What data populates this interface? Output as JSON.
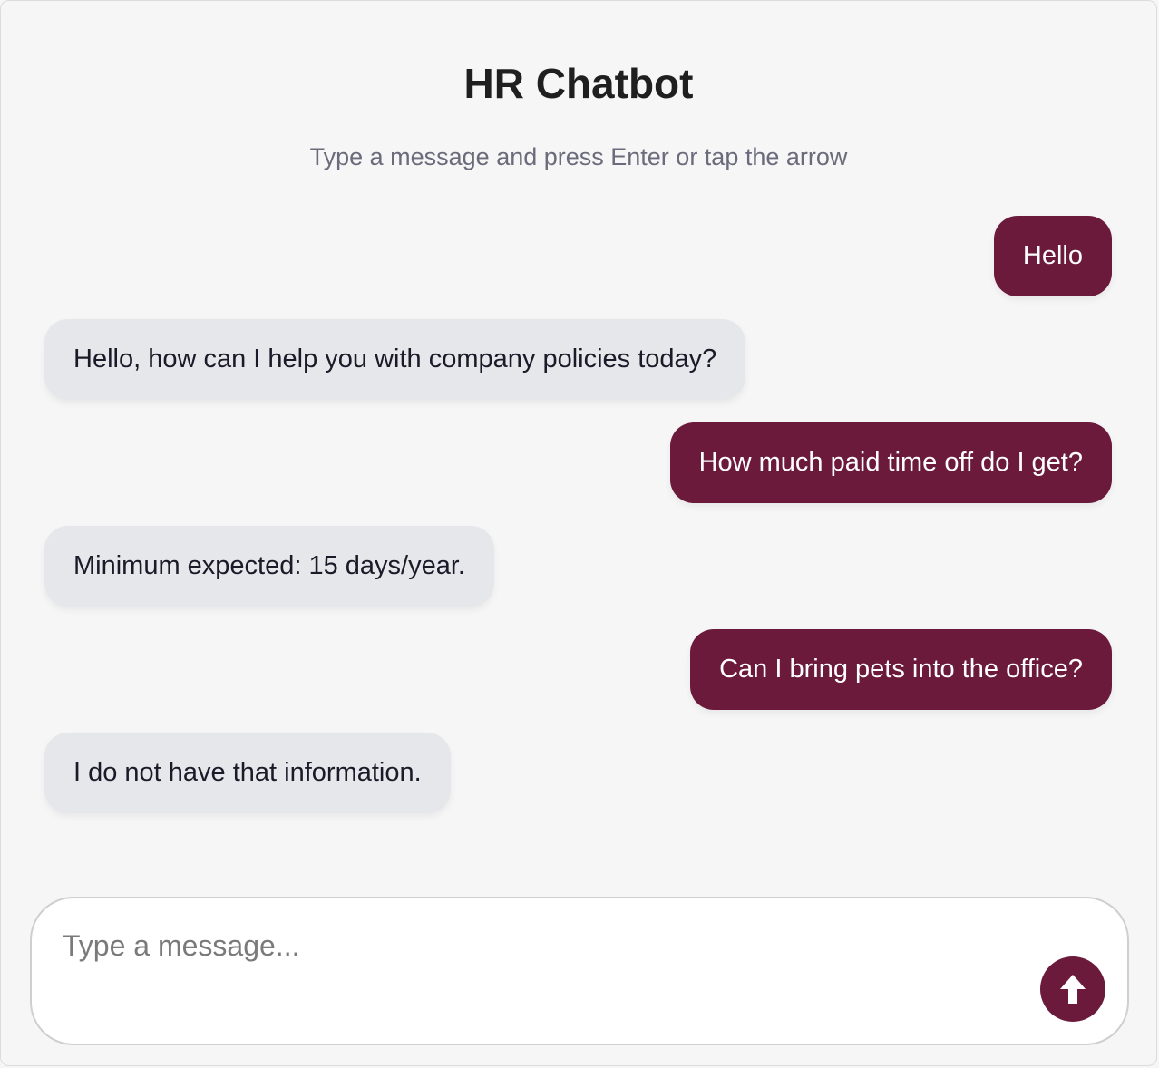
{
  "header": {
    "title": "HR Chatbot",
    "subtitle": "Type a message and press Enter or tap the arrow"
  },
  "messages": [
    {
      "role": "user",
      "text": "Hello"
    },
    {
      "role": "bot",
      "text": "Hello, how can I help you with company policies today?"
    },
    {
      "role": "user",
      "text": "How much paid time off do I get?"
    },
    {
      "role": "bot",
      "text": "Minimum expected: 15 days/year."
    },
    {
      "role": "user",
      "text": "Can I bring pets into the office?"
    },
    {
      "role": "bot",
      "text": "I do not have that information."
    }
  ],
  "composer": {
    "placeholder": "Type a message...",
    "value": "",
    "send_icon": "arrow-up-icon"
  },
  "colors": {
    "accent": "#6b1a3b",
    "bot_bubble": "#e6e7ea",
    "background": "#f6f6f6"
  }
}
